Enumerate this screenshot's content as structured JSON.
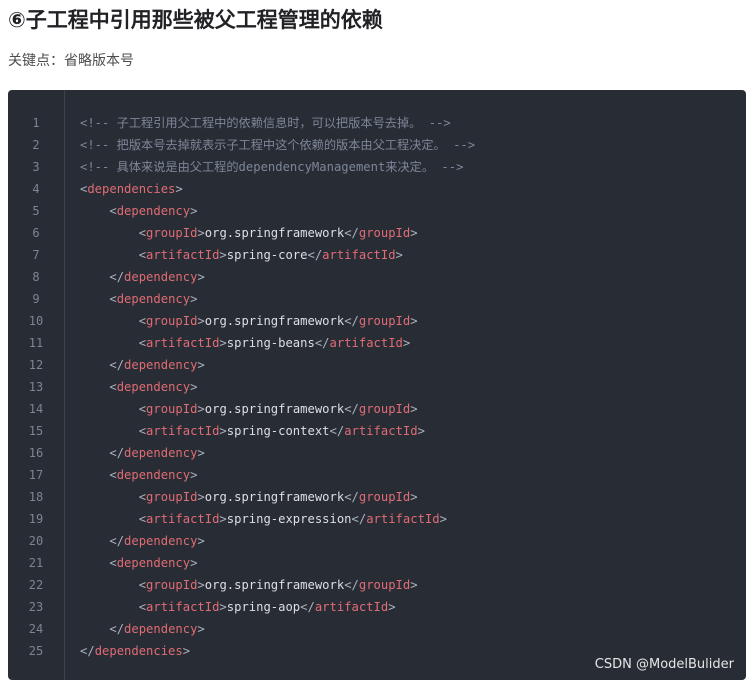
{
  "article": {
    "heading": "⑥子工程中引用那些被父工程管理的依赖",
    "subtext": "关键点：省略版本号"
  },
  "code": {
    "line_numbers": [
      "1",
      "2",
      "3",
      "4",
      "5",
      "6",
      "7",
      "8",
      "9",
      "10",
      "11",
      "12",
      "13",
      "14",
      "15",
      "16",
      "17",
      "18",
      "19",
      "20",
      "21",
      "22",
      "23",
      "24",
      "25"
    ],
    "comments": [
      "<!-- 子工程引用父工程中的依赖信息时，可以把版本号去掉。 -->",
      "<!-- 把版本号去掉就表示子工程中这个依赖的版本由父工程决定。 -->",
      "<!-- 具体来说是由父工程的dependencyManagement来决定。 -->"
    ],
    "tags": {
      "dependencies": "dependencies",
      "dependency": "dependency",
      "groupId": "groupId",
      "artifactId": "artifactId"
    },
    "group_id_value": "org.springframework",
    "artifacts": [
      "spring-core",
      "spring-beans",
      "spring-context",
      "spring-expression",
      "spring-aop"
    ]
  },
  "watermark": "CSDN @ModelBulider",
  "colors": {
    "code_background": "#282c34",
    "tag": "#e06c75",
    "comment": "#7d8799",
    "text": "#dcdfe4"
  }
}
